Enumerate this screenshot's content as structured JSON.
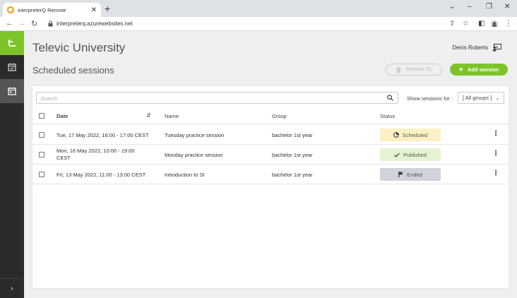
{
  "browser": {
    "tab_title": "interpreterQ Remote",
    "tab_close": "✕",
    "new_tab": "+",
    "url": "interpreterq.azurewebsites.net"
  },
  "header": {
    "org_name": "Televic University",
    "user_name": "Denis Roberts",
    "page_title": "Scheduled sessions",
    "remove_label": "Remove (0)",
    "add_label": "Add session"
  },
  "filters": {
    "search_placeholder": "Search",
    "show_label": "Show sessions for :",
    "group_value": "[ All groups ]"
  },
  "table": {
    "columns": [
      "Date",
      "Name",
      "Group",
      "Status"
    ],
    "rows": [
      {
        "date": "Tue, 17 May 2022, 16:00 - 17:00 CEST",
        "name": "Tuesday practice session",
        "group": "bachelor 1st year",
        "status": "Scheduled",
        "status_kind": "scheduled"
      },
      {
        "date": "Mon, 16 May 2022, 10:00 - 19:00 CEST",
        "name": "Monday practice session",
        "group": "bachelor 1st year",
        "status": "Published",
        "status_kind": "published"
      },
      {
        "date": "Fri, 13 May 2022, 11:00 - 13:00 CEST",
        "name": "Introduction to SI",
        "group": "bachelor 1st year",
        "status": "Ended",
        "status_kind": "ended"
      }
    ]
  },
  "colors": {
    "accent": "#7dc42a",
    "sidebar": "#2b2b2b",
    "scheduled_bg": "#fdf1c4",
    "published_bg": "#e4f4d3",
    "ended_bg": "#d0d2dc"
  }
}
